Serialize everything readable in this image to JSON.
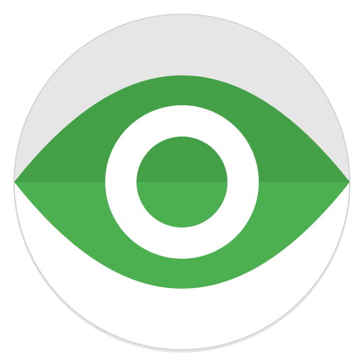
{
  "icon": {
    "name": "eye-icon",
    "colors": {
      "disc_upper": "#e6e6e6",
      "disc_lower": "#ffffff",
      "disc_edge": "#d0d0d0",
      "eye_upper": "#43a047",
      "eye_lower": "#4caf50",
      "iris_ring": "#ffffff",
      "pupil_upper": "#43a047",
      "pupil_lower": "#4caf50"
    }
  }
}
